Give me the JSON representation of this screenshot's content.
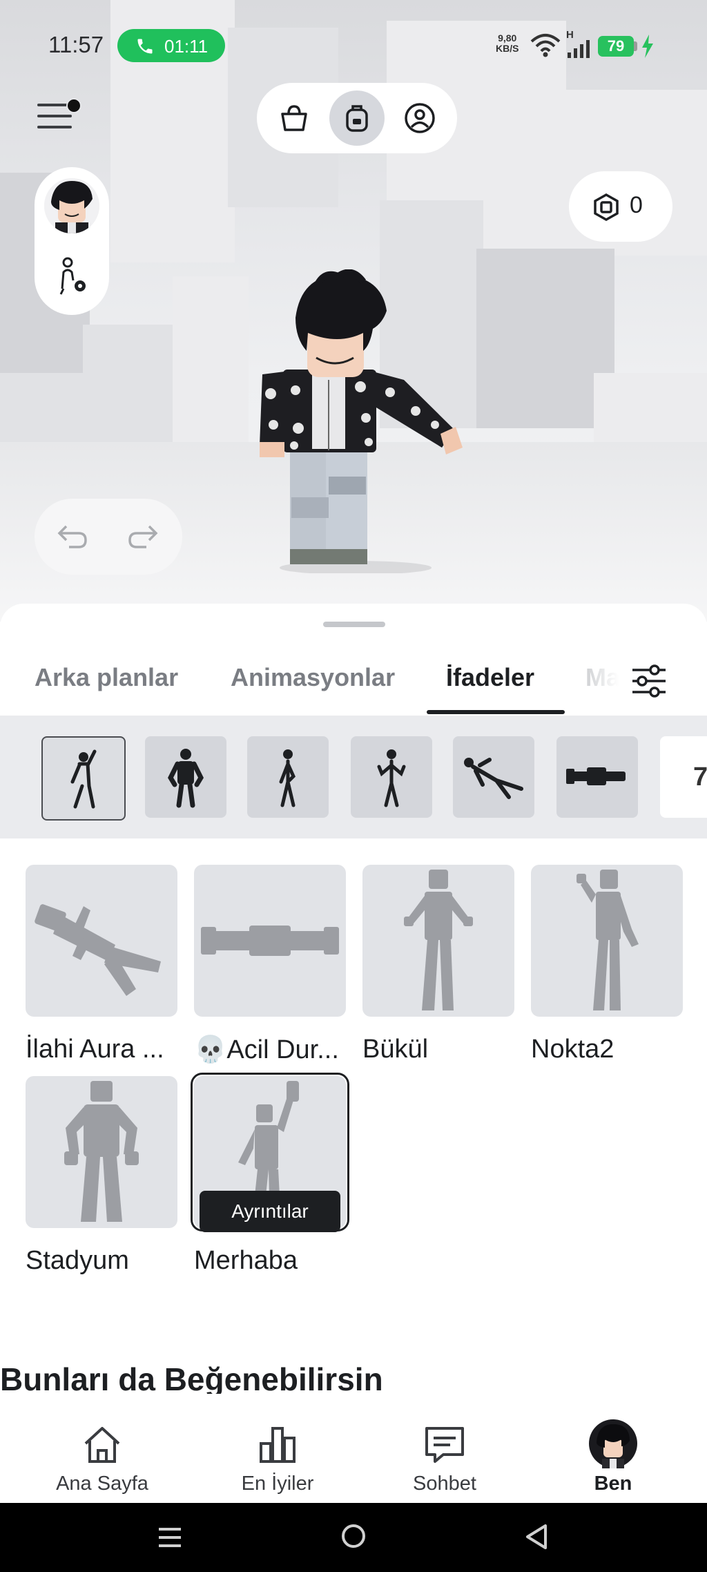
{
  "status_bar": {
    "time": "11:57",
    "call_timer": "01:11",
    "net_speed_value": "9,80",
    "net_speed_unit": "KB/S",
    "network_type": "H",
    "battery": "79"
  },
  "top_tabs": [
    "shop-bag-icon",
    "backpack-icon",
    "profile-icon"
  ],
  "robux": {
    "balance": "0"
  },
  "sheet": {
    "tabs": [
      {
        "label": "Arka planlar"
      },
      {
        "label": "Animasyonlar"
      },
      {
        "label": "İfadeler",
        "active": true
      },
      {
        "label": "Ma"
      }
    ],
    "chip_more": "7",
    "items": [
      {
        "label": "İlahi Aura ..."
      },
      {
        "label": "💀Acil Dur..."
      },
      {
        "label": "Bükül"
      },
      {
        "label": "Nokta2"
      },
      {
        "label": "Stadyum"
      },
      {
        "label": "Merhaba",
        "selected": true
      }
    ],
    "details_button": "Ayrıntılar",
    "section_title": "Bunları da Beğenebilirsin"
  },
  "bottom_nav": [
    {
      "label": "Ana Sayfa"
    },
    {
      "label": "En İyiler"
    },
    {
      "label": "Sohbet"
    },
    {
      "label": "Ben",
      "active": true
    }
  ],
  "colors": {
    "call_green": "#20c05c",
    "battery_green": "#28c15e",
    "text_dark": "#1d1f22",
    "chip_bg": "#d4d6db"
  }
}
